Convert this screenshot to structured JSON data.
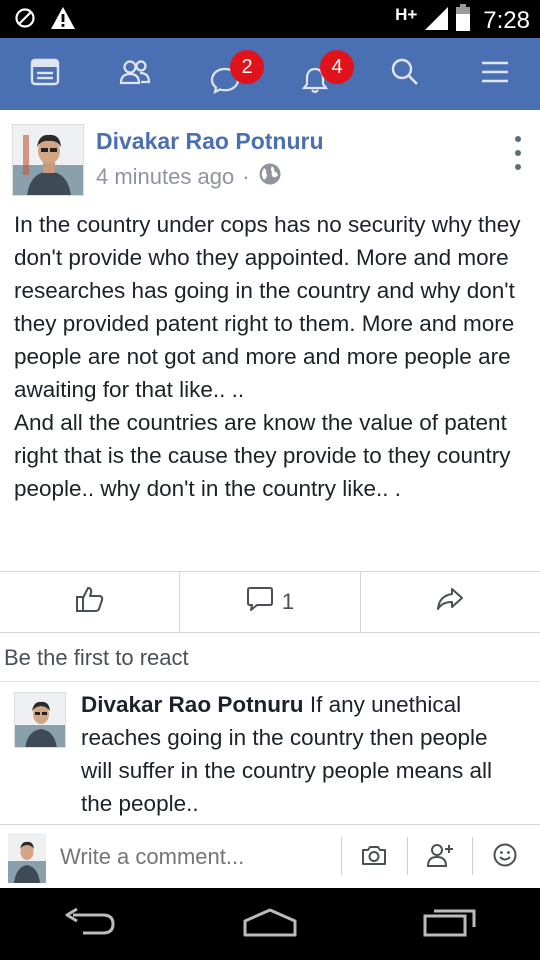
{
  "status_bar": {
    "network": "H+",
    "time": "7:28"
  },
  "nav": {
    "items": [
      {
        "icon": "news-feed-icon"
      },
      {
        "icon": "friends-icon"
      },
      {
        "icon": "messages-icon",
        "badge": "2"
      },
      {
        "icon": "notifications-icon",
        "badge": "4"
      },
      {
        "icon": "search-icon"
      },
      {
        "icon": "menu-icon"
      }
    ],
    "color": "#4b6fb3",
    "badge_color": "#e0131b"
  },
  "post": {
    "author": "Divakar Rao Potnuru",
    "time": "4 minutes ago",
    "separator": "·",
    "body_p1": "In the country under cops has no security why they don't provide who they appointed. More and more researches has going in the country and why don't they provided patent right to them. More and more people are not got and more and more people are awaiting for that like.. ..",
    "body_p2": "And all the countries are know the value of patent right that is the cause they provide to they country people.. why don't in the country like.. ."
  },
  "actions": {
    "like_icon": "thumbs-up-icon",
    "comment_icon": "comment-icon",
    "comment_count": "1",
    "share_icon": "share-icon"
  },
  "reactions": {
    "text": "Be the first to react"
  },
  "comment": {
    "author": "Divakar Rao Potnuru",
    "text": "If any unethical reaches going in the country then people will suffer in the country people means all the people.."
  },
  "composer": {
    "placeholder": "Write a comment...",
    "buttons": [
      "camera-icon",
      "add-friend-icon",
      "emoji-icon"
    ]
  },
  "system_nav": [
    "back-icon",
    "home-icon",
    "recents-icon"
  ]
}
